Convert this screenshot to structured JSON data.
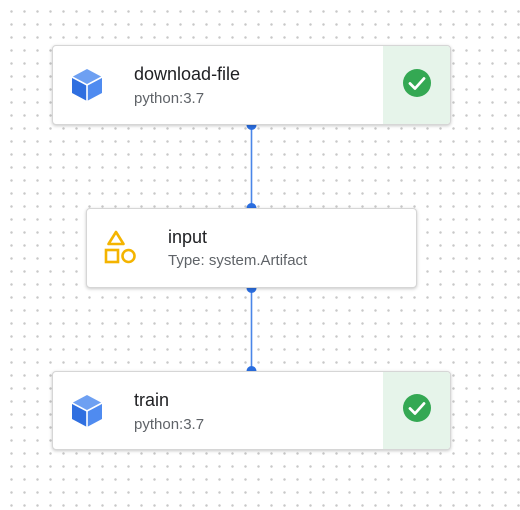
{
  "pipeline": {
    "nodes": [
      {
        "title": "download-file",
        "subtitle": "python:3.7",
        "icon": "cube-icon",
        "status": "succeeded",
        "status_icon": "check-circle-icon"
      },
      {
        "title": "input",
        "subtitle": "Type: system.Artifact",
        "icon": "artifact-shapes-icon"
      },
      {
        "title": "train",
        "subtitle": "python:3.7",
        "icon": "cube-icon",
        "status": "succeeded",
        "status_icon": "check-circle-icon"
      }
    ],
    "edges": [
      {
        "from": "download-file",
        "to": "input"
      },
      {
        "from": "input",
        "to": "train"
      }
    ]
  },
  "colors": {
    "edge": "#4a86e8",
    "cube_blue": "#3f7ee8",
    "artifact_yellow": "#f4b400",
    "success_green": "#34a853",
    "status_panel_bg": "#e6f4ea"
  }
}
